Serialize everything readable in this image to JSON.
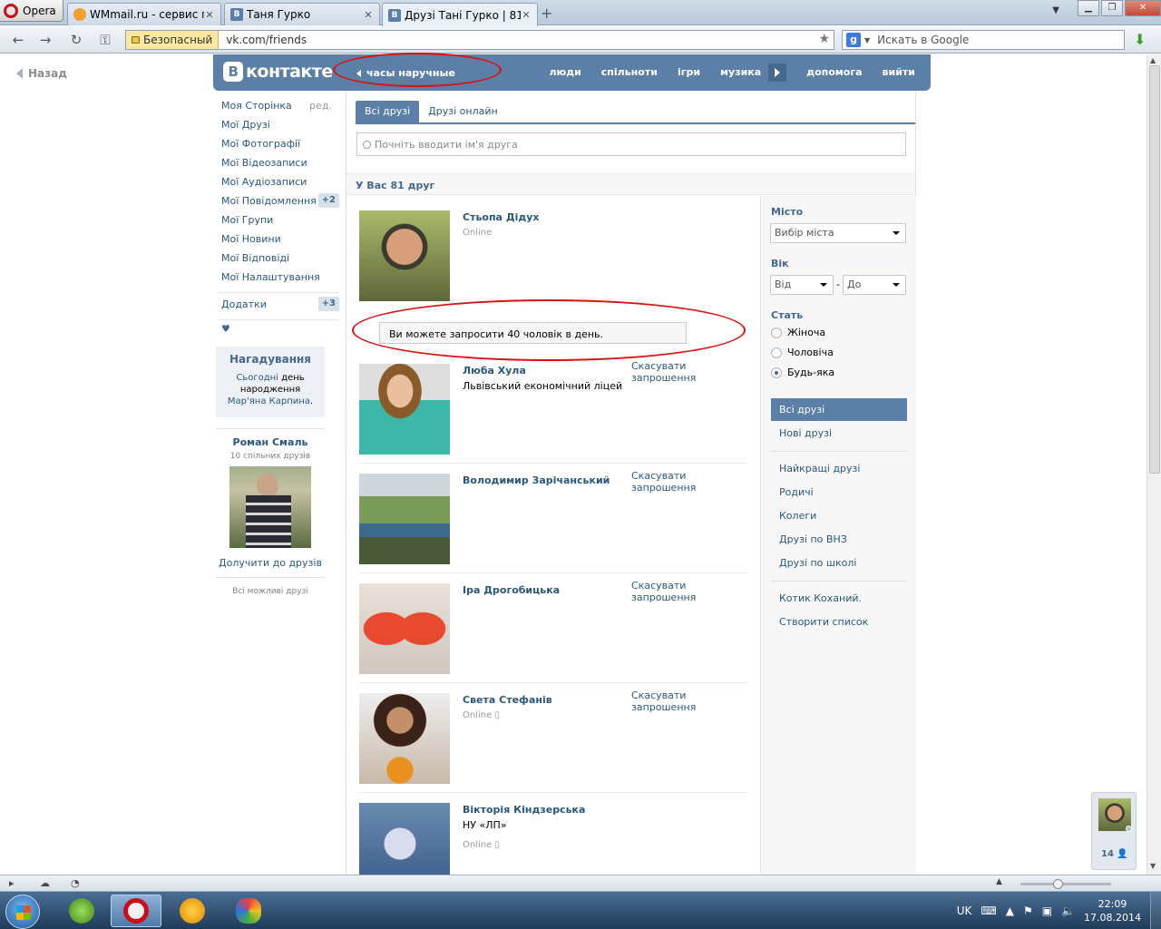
{
  "browser": {
    "menu_label": "Opera",
    "tabs": [
      {
        "title": "WMmail.ru - сервис п..."
      },
      {
        "title": "Таня Гурко"
      },
      {
        "title": "Друзі Тані Гурко | 81 д..."
      }
    ],
    "secure_label": "Безопасный",
    "url": "vk.com/friends",
    "search_placeholder": "Искать в Google",
    "search_engine_icon": "google-icon"
  },
  "page": {
    "back_label": "Назад",
    "logo_text": "контакте",
    "logo_badge": "В",
    "status_text": "часы наручные",
    "top_nav": [
      "люди",
      "спільноти",
      "ігри",
      "музика",
      "допомога",
      "вийти"
    ],
    "left_menu": [
      {
        "label": "Моя Сторінка",
        "extra": "ред."
      },
      {
        "label": "Мої Друзі"
      },
      {
        "label": "Мої Фотографії"
      },
      {
        "label": "Мої Відеозаписи"
      },
      {
        "label": "Мої Аудіозаписи"
      },
      {
        "label": "Мої Повідомлення",
        "badge": "+2"
      },
      {
        "label": "Мої Групи"
      },
      {
        "label": "Мої Новини"
      },
      {
        "label": "Мої Відповіді"
      },
      {
        "label": "Мої Налаштування"
      }
    ],
    "apps": {
      "label": "Додатки",
      "badge": "+3"
    },
    "heart": "♥",
    "reminder": {
      "title": "Нагадування",
      "today": "Сьогодні",
      "text": "день народження",
      "name": "Мар'яна Карпина",
      "dot": "."
    },
    "suggestion": {
      "name": "Роман Смаль",
      "mutual": "10 спільних друзів",
      "add_label": "Долучити до друзів",
      "all_label": "Всі можливі друзі"
    },
    "tabs": [
      "Всі друзі",
      "Друзі онлайн"
    ],
    "search_placeholder": "Почніть вводити ім'я друга",
    "count_text": "У Вас 81 друг",
    "invite_notice": "Ви можете запросити 40 чоловік в день.",
    "cancel_label": "Скасувати запрошення",
    "online_label": "Online",
    "friends": [
      {
        "name": "Стьопа Дідух",
        "sub": "",
        "online": true
      },
      {
        "name": "Люба Хула",
        "sub": "Львівський економічний ліцей",
        "online": false
      },
      {
        "name": "Володимир Зарічанський",
        "sub": "",
        "online": false
      },
      {
        "name": "Іра Дрогобицька",
        "sub": "",
        "online": false
      },
      {
        "name": "Света Стефанів",
        "sub": "",
        "online": true
      },
      {
        "name": "Вікторія Кіндзерська",
        "sub": "НУ «ЛП»",
        "online": true
      }
    ],
    "filters": {
      "city_label": "Місто",
      "city_select": "Вибір міста",
      "age_label": "Вік",
      "age_from": "Від",
      "age_dash": "-",
      "age_to": "До",
      "sex_label": "Стать",
      "sex_options": [
        "Жіноча",
        "Чоловіча",
        "Будь-яка"
      ],
      "sex_selected": "Будь-яка",
      "lists_a": [
        "Всі друзі",
        "Нові друзі"
      ],
      "lists_b": [
        "Найкращі друзі",
        "Родичі",
        "Колеги",
        "Друзі по ВНЗ",
        "Друзі по школі"
      ],
      "lists_c": [
        "Котик Коханий.",
        "Створити список"
      ]
    },
    "chat_count": "14"
  },
  "taskbar": {
    "lang": "UK",
    "time": "22:09",
    "date": "17.08.2014"
  },
  "colors": {
    "vk_blue": "#5b7fa6",
    "link": "#2b587a",
    "annotation_red": "#dd1010"
  }
}
